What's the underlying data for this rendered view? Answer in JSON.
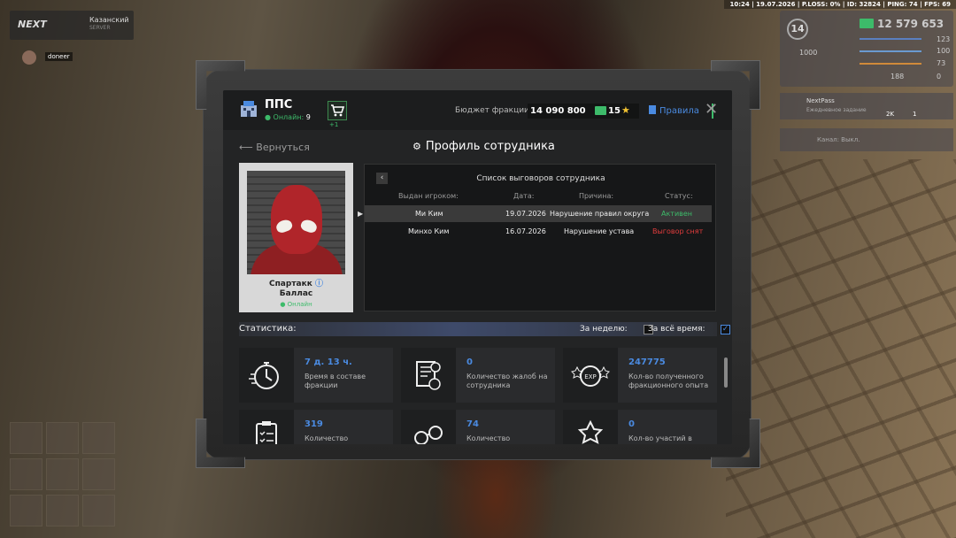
{
  "hud": {
    "topbar": "10:24 | 19.07.2026 | P.LOSS: 0% | ID: 32824 | PING: 74 | FPS: 69",
    "logo": "NEXT",
    "server_name": "Казанский",
    "server_sub": "SERVER",
    "player_name": "doneer",
    "level": "14",
    "money": "12 579 653",
    "health": "123",
    "armor": "100",
    "hunger": "73",
    "stat_zero": "0",
    "stat_1000": "1000",
    "stat_188": "188",
    "nextpass_title": "NextPass",
    "nextpass_sub": "Ежедневное задание",
    "nextpass_reward1": "2K",
    "nextpass_reward2": "1",
    "channel": "Канал: Выкл."
  },
  "header": {
    "faction_name": "ППС",
    "online_label": "Онлайн:",
    "online_count": "9",
    "cart_badge": "+1",
    "budget_label": "Бюджет фракции:",
    "budget_value": "14 090 800",
    "stars_value": "15",
    "rules_label": "Правила",
    "close_glyph": "✕"
  },
  "page": {
    "back_label": "Вернуться",
    "title": "Профиль сотрудника"
  },
  "profile": {
    "name_line1": "Спартакк",
    "name_line2": "Баллас",
    "status": "Онлайн"
  },
  "warnings": {
    "title": "Список выговоров сотрудника",
    "columns": [
      "Выдан игроком:",
      "Дата:",
      "Причина:",
      "Статус:"
    ],
    "rows": [
      {
        "issuer": "Ми Ким",
        "date": "19.07.2026",
        "reason": "Нарушение правил округа",
        "status": "Активен",
        "status_color": "#3dbb6a"
      },
      {
        "issuer": "Минхо Ким",
        "date": "16.07.2026",
        "reason": "Нарушение устава",
        "status": "Выговор снят",
        "status_color": "#e03c3c"
      }
    ]
  },
  "stats": {
    "label": "Статистика:",
    "week_label": "За неделю:",
    "week_checked": false,
    "all_label": "За всё время:",
    "all_checked": true,
    "tiles": [
      {
        "value": "7 д. 13 ч.",
        "desc": "Время в составе фракции",
        "icon": "stopwatch-icon"
      },
      {
        "value": "0",
        "desc": "Количество жалоб на сотрудника",
        "icon": "complaint-doc-icon"
      },
      {
        "value": "247775",
        "desc": "Кол-во полученного фракционного опыта",
        "icon": "exp-badge-icon"
      },
      {
        "value": "319",
        "desc": "Количество",
        "icon": "clipboard-icon"
      },
      {
        "value": "74",
        "desc": "Количество",
        "icon": "handcuffs-icon"
      },
      {
        "value": "0",
        "desc": "Кол-во участий в",
        "icon": "star-podium-icon"
      }
    ]
  }
}
